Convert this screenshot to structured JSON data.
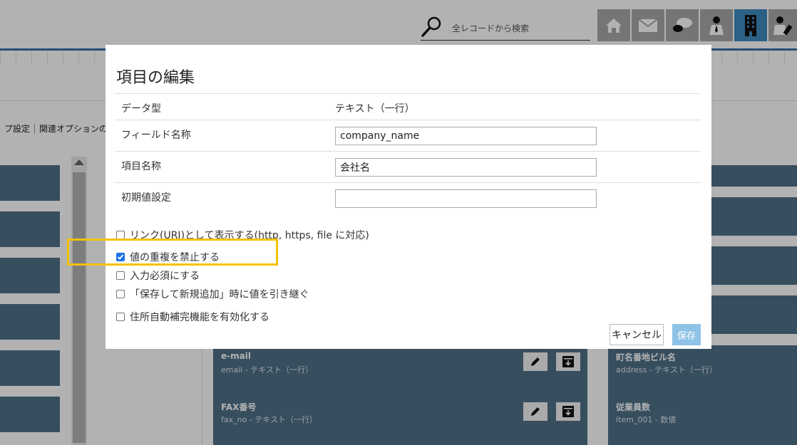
{
  "search": {
    "placeholder": "全レコードから検索"
  },
  "nav": [
    {
      "name": "home-icon"
    },
    {
      "name": "mail-icon"
    },
    {
      "name": "chat-icon"
    },
    {
      "name": "user-icon"
    },
    {
      "name": "building-icon",
      "active": true
    },
    {
      "name": "user-edit-icon"
    }
  ],
  "subtabs": {
    "left": "プ設定",
    "right": "関連オプションの表"
  },
  "field_cards": [
    {
      "title": "e-mail",
      "subtitle": "email - テキスト（一行）"
    },
    {
      "title": "FAX番号",
      "subtitle": "fax_no - テキスト（一行）"
    }
  ],
  "right_cards": [
    {
      "title": "町名番地ビル名",
      "subtitle": "address - テキスト（一行）"
    },
    {
      "title": "従業員数",
      "subtitle": "item_001 - 数値"
    }
  ],
  "modal": {
    "title": "項目の編集",
    "rows": {
      "data_type": {
        "label": "データ型",
        "value": "テキスト（一行）"
      },
      "field_name": {
        "label": "フィールド名称",
        "value": "company_name"
      },
      "item_name": {
        "label": "項目名称",
        "value": "会社名"
      },
      "default_value": {
        "label": "初期値設定",
        "value": ""
      }
    },
    "options": [
      {
        "label": "リンク(URI)として表示する(http, https, file に対応)",
        "checked": false
      },
      {
        "label": "値の重複を禁止する",
        "checked": true
      },
      {
        "label": "入力必須にする",
        "checked": false
      },
      {
        "label": "「保存して新規追加」時に値を引き継ぐ",
        "checked": false
      },
      {
        "label": "住所自動補完機能を有効化する",
        "checked": false
      }
    ],
    "cancel_label": "キャンセル",
    "save_label": "保存"
  },
  "colors": {
    "card": "#4f7089",
    "nav_active": "#3f8cc1",
    "highlight": "#f2c200",
    "save": "#8ec2e6"
  }
}
